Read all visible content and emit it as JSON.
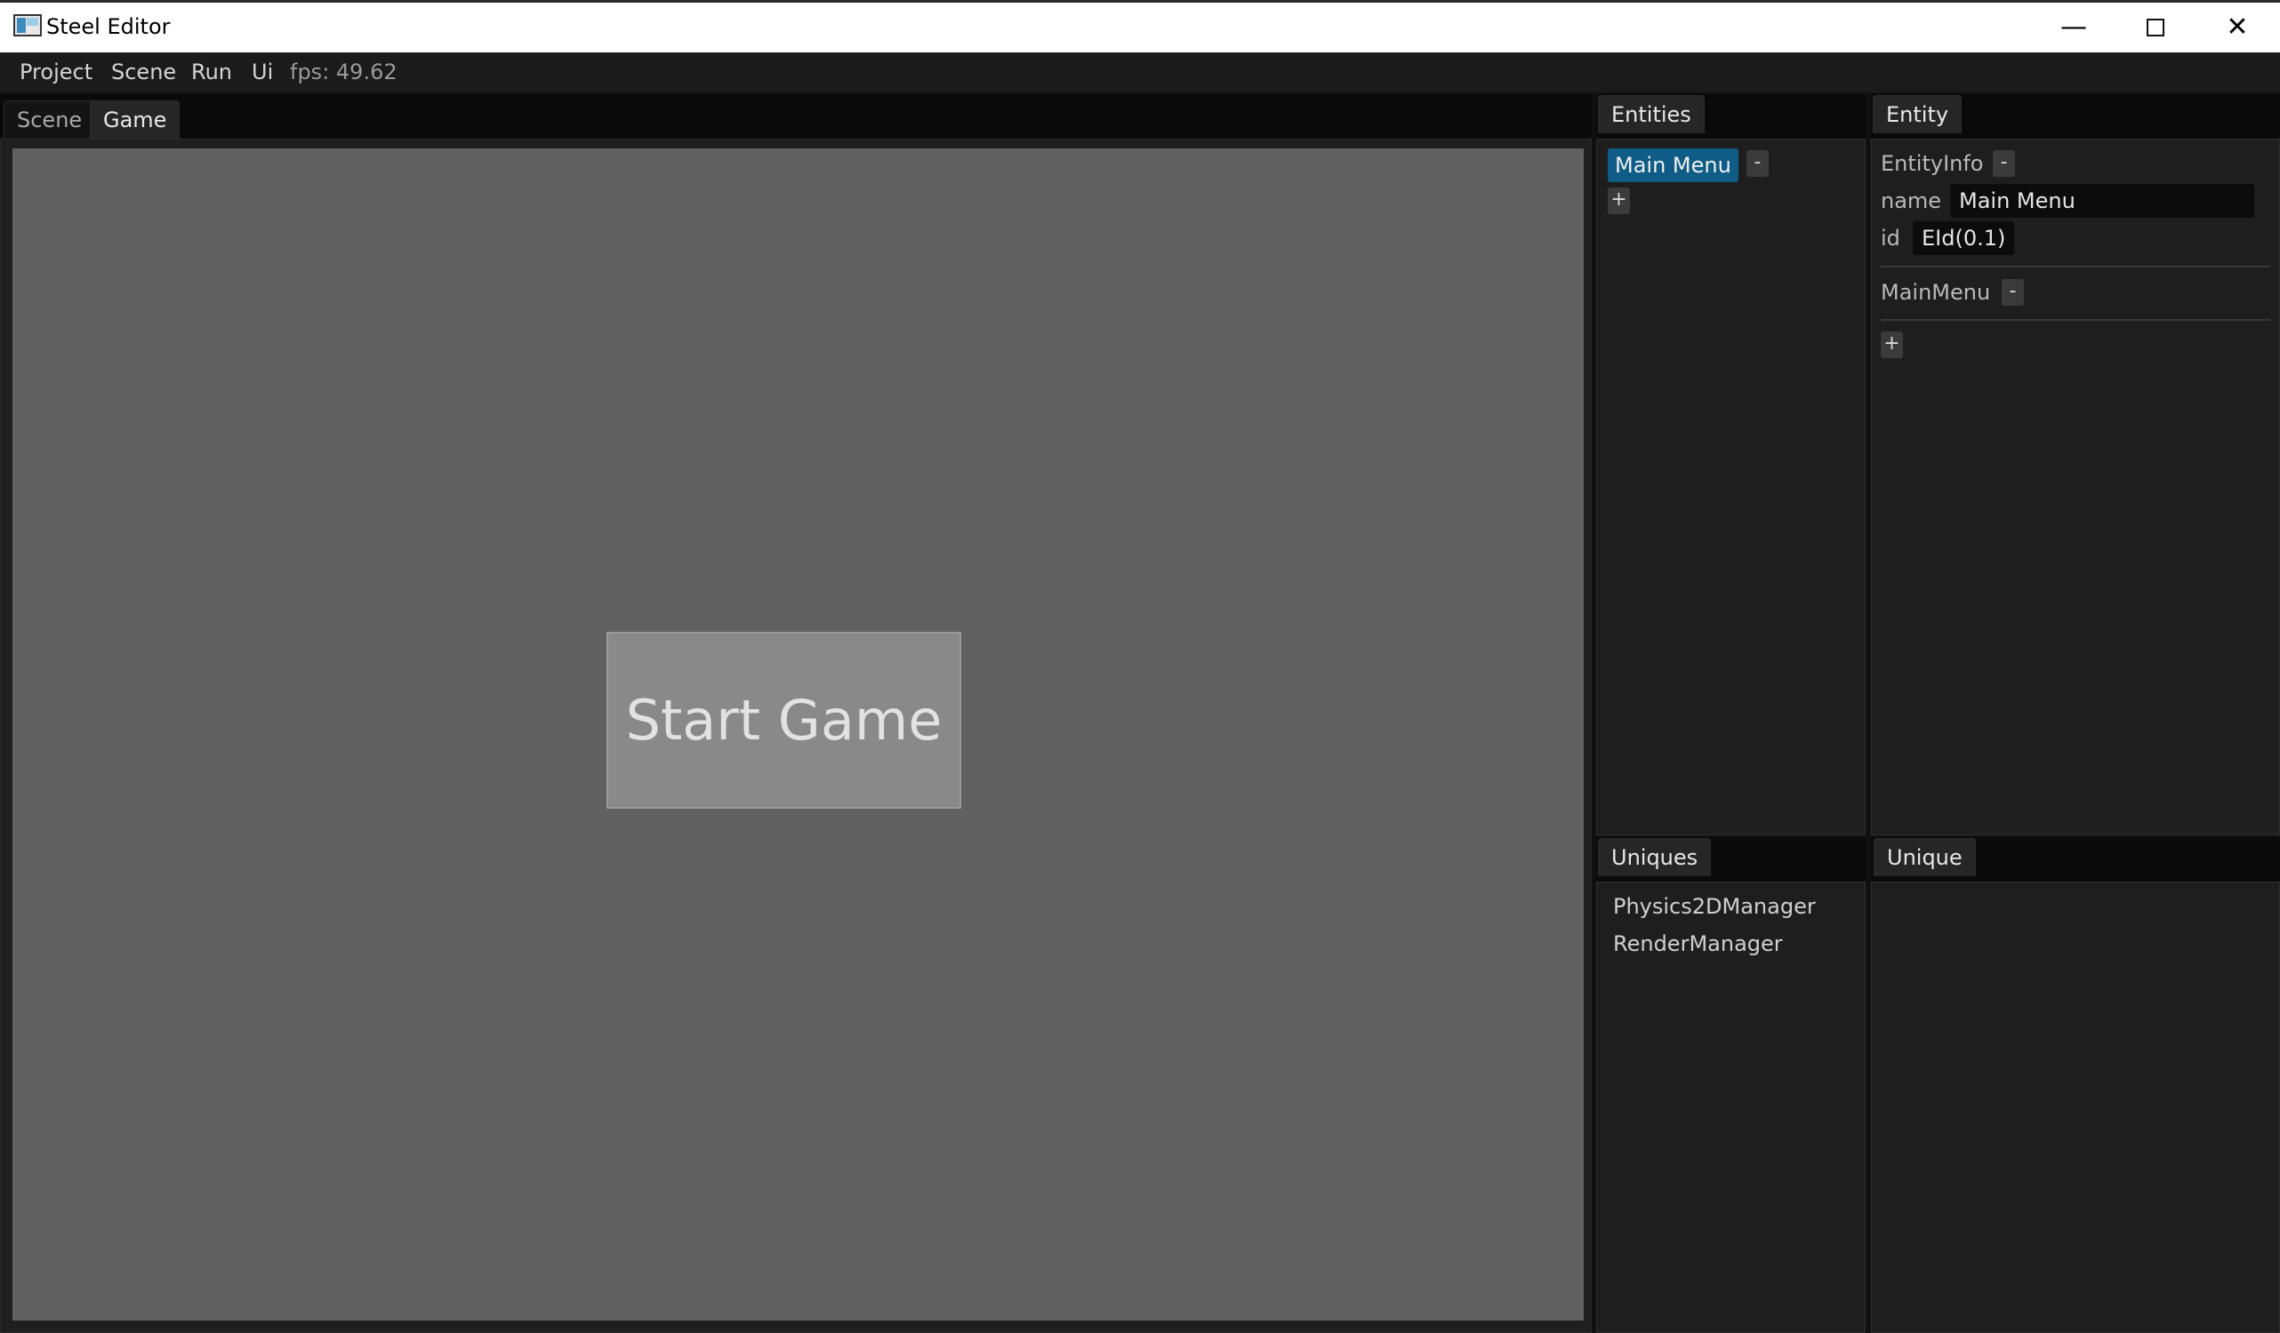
{
  "window": {
    "title": "Steel Editor",
    "minimize_glyph": "—",
    "close_glyph": "✕"
  },
  "menu": {
    "items": [
      "Project",
      "Scene",
      "Run",
      "Ui"
    ],
    "fps": "fps: 49.62"
  },
  "viewport_tabs": [
    "Scene",
    "Game"
  ],
  "game": {
    "start_button": "Start Game"
  },
  "entities_panel": {
    "tab": "Entities",
    "selected_entity": "Main Menu",
    "remove_label": "-",
    "add_label": "+"
  },
  "entity_panel": {
    "tab": "Entity",
    "component1": "EntityInfo",
    "remove_label": "-",
    "name_label": "name",
    "name_value": "Main Menu",
    "id_label": "id",
    "id_value": "EId(0.1)",
    "component2": "MainMenu",
    "add_label": "+"
  },
  "uniques_panel": {
    "tab": "Uniques",
    "items": [
      "Physics2DManager",
      "RenderManager"
    ]
  },
  "unique_panel": {
    "tab": "Unique"
  },
  "colors": {
    "selection": "#0f5c87",
    "viewport": "#606060",
    "button": "#898989"
  }
}
